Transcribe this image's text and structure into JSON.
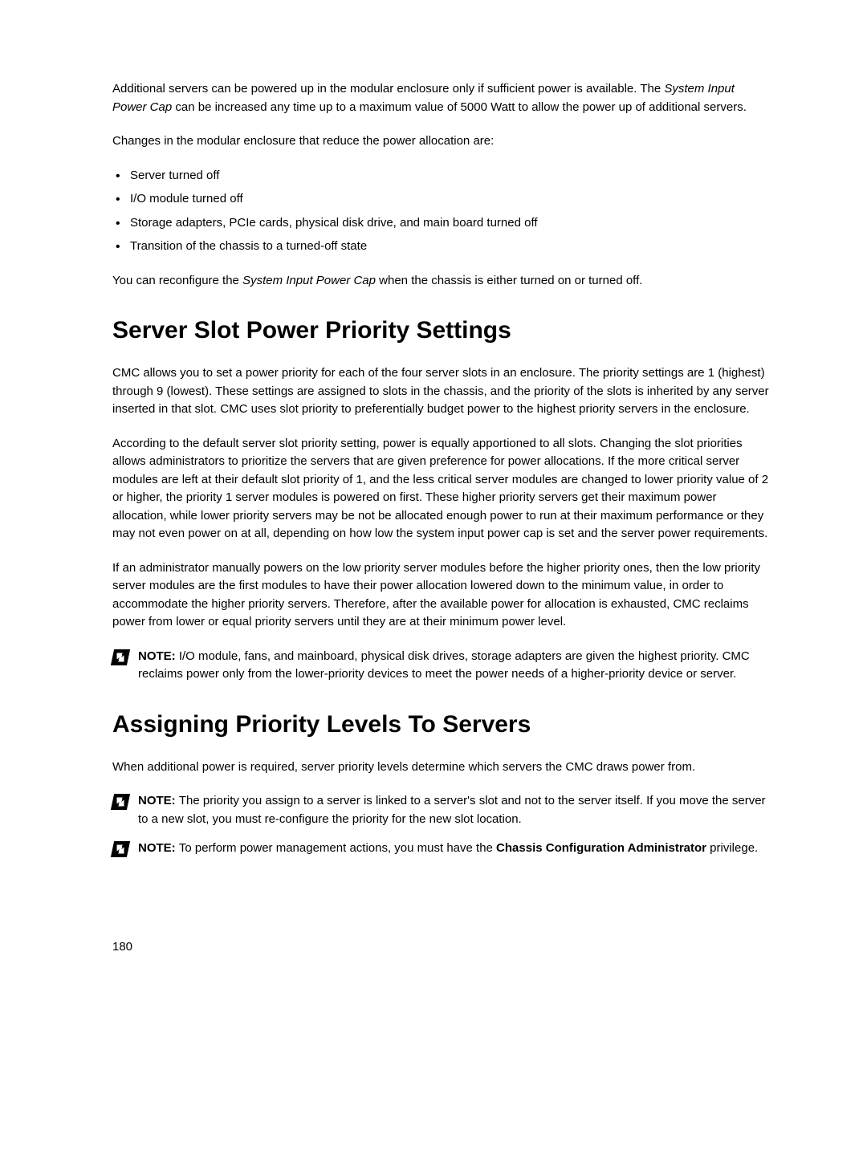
{
  "intro": {
    "p1_a": "Additional servers can be powered up in the modular enclosure only if sufficient power is available. The ",
    "p1_italic": "System Input Power Cap",
    "p1_b": " can be increased any time up to a maximum value of 5000 Watt to allow the power up of additional servers.",
    "p2": "Changes in the modular enclosure that reduce the power allocation are:",
    "bullets": [
      "Server turned off",
      "I/O module turned off",
      "Storage adapters, PCIe cards, physical disk drive, and main board turned off",
      "Transition of the chassis to a turned-off state"
    ],
    "p3_a": "You can reconfigure the ",
    "p3_italic": "System Input Power Cap",
    "p3_b": " when the chassis is either turned on or turned off."
  },
  "section1": {
    "heading": "Server Slot Power Priority Settings",
    "p1": "CMC allows you to set a power priority for each of the four server slots in an enclosure. The priority settings are 1 (highest) through 9 (lowest). These settings are assigned to slots in the chassis, and the priority of the slots is inherited by any server inserted in that slot. CMC uses slot priority to preferentially budget power to the highest priority servers in the enclosure.",
    "p2": "According to the default server slot priority setting, power is equally apportioned to all slots. Changing the slot priorities allows administrators to prioritize the servers that are given preference for power allocations. If the more critical server modules are left at their default slot priority of 1, and the less critical server modules are changed to lower priority value of 2 or higher, the priority 1 server modules is powered on first. These higher priority servers get their maximum power allocation, while lower priority servers may be not be allocated enough power to run at their maximum performance or they may not even power on at all, depending on how low the system input power cap is set and the server power requirements.",
    "p3": "If an administrator manually powers on the low priority server modules before the higher priority ones, then the low priority server modules are the first modules to have their power allocation lowered down to the minimum value, in order to accommodate the higher priority servers. Therefore, after the available power for allocation is exhausted, CMC reclaims power from lower or equal priority servers until they are at their minimum power level.",
    "note1_label": "NOTE: ",
    "note1_text": "I/O module, fans, and mainboard, physical disk drives, storage adapters are given the highest priority. CMC reclaims power only from the lower-priority devices to meet the power needs of a higher-priority device or server."
  },
  "section2": {
    "heading": "Assigning Priority Levels To Servers",
    "p1": "When additional power is required, server priority levels determine which servers the CMC draws power from.",
    "note1_label": "NOTE: ",
    "note1_text": "The priority you assign to a server is linked to a server's slot and not to the server itself. If you move the server to a new slot, you must re-configure the priority for the new slot location.",
    "note2_label": "NOTE: ",
    "note2_text_a": "To perform power management actions, you must have the ",
    "note2_bold": "Chassis Configuration Administrator",
    "note2_text_b": " privilege."
  },
  "page_number": "180"
}
